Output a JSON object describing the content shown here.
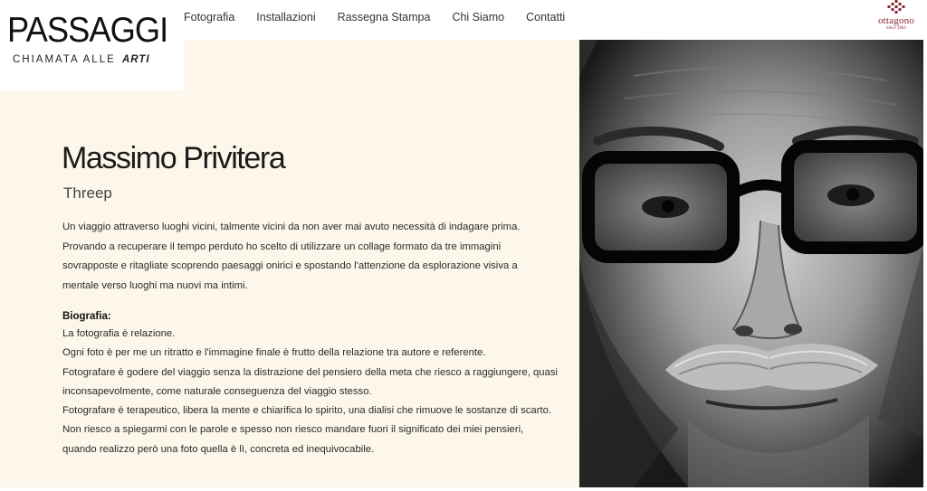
{
  "header": {
    "logo": {
      "title": "PASSAGGI",
      "tagline": "CHIAMATA ALLE",
      "tagline_accent": "ARTI"
    },
    "nav": [
      {
        "label": "Fotografia"
      },
      {
        "label": "Installazioni"
      },
      {
        "label": "Rassegna Stampa"
      },
      {
        "label": "Chi Siamo"
      },
      {
        "label": "Contatti"
      }
    ],
    "brand": {
      "name": "ottagono",
      "sub": "Since 1965",
      "color": "#8a2432"
    }
  },
  "main": {
    "artist_name": "Massimo Privitera",
    "project_title": "Threep",
    "description_lines": [
      "Un viaggio attraverso luoghi vicini, talmente vicini da non aver mai avuto necessità di indagare prima.",
      "Provando a recuperare il tempo perduto ho scelto di utilizzare un collage formato da tre immagini",
      "sovrapposte e ritagliate scoprendo paesaggi onirici e spostando l'attenzione da esplorazione visiva a",
      "mentale verso luoghi ma nuovi ma intimi."
    ],
    "bio_heading": "Biografia:",
    "bio_lines": [
      "La fotografia è relazione.",
      "Ogni foto è per me un ritratto e l'immagine finale è frutto della relazione tra autore e referente.",
      "Fotografare è godere del viaggio senza la distrazione del pensiero della meta che riesco a raggiungere, quasi",
      "inconsapevolmente, come naturale conseguenza del viaggio stesso.",
      "Fotografare è terapeutico, libera la mente e chiarifica lo spirito, una dialisi che rimuove le sostanze di scarto.",
      "Non riesco a spiegarmi con le parole e spesso non riesco mandare fuori il significato dei miei pensieri,",
      "quando realizzo però una foto quella è lì, concreta ed inequivocabile."
    ],
    "panel_color": "#fdf6ea"
  }
}
